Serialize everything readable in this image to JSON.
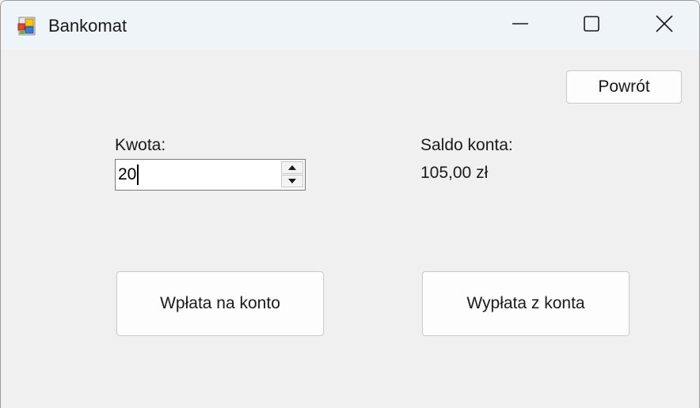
{
  "window": {
    "title": "Bankomat"
  },
  "toolbar": {
    "back_label": "Powrót"
  },
  "form": {
    "amount_label": "Kwota:",
    "amount_value": "20",
    "balance_label": "Saldo konta:",
    "balance_value": "105,00 zł"
  },
  "actions": {
    "deposit_label": "Wpłata na konto",
    "withdraw_label": "Wypłata z konta"
  },
  "icons": {
    "app": "app-icon",
    "minimize": "minimize-icon",
    "maximize": "maximize-icon",
    "close": "close-icon",
    "spin_up": "arrow-up-icon",
    "spin_down": "arrow-down-icon"
  }
}
